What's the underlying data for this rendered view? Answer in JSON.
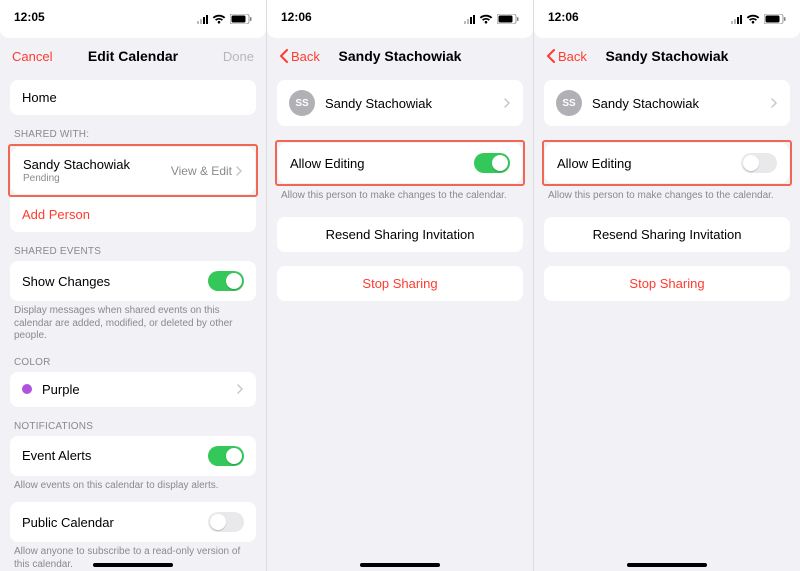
{
  "status": {
    "signal_label": "signal",
    "wifi_label": "wifi",
    "battery_label": "battery"
  },
  "screens": [
    {
      "time": "12:05",
      "nav": {
        "left": "Cancel",
        "title": "Edit Calendar",
        "right": "Done",
        "back_arrow": false
      },
      "cal_name": "Home",
      "headers": {
        "shared_with": "SHARED WITH:",
        "shared_events": "SHARED EVENTS",
        "color": "COLOR",
        "notifications": "NOTIFICATIONS"
      },
      "shared_person": {
        "name": "Sandy Stachowiak",
        "status": "Pending",
        "perm": "View & Edit"
      },
      "add_person": "Add Person",
      "show_changes": {
        "label": "Show Changes",
        "on": true
      },
      "show_changes_footer": "Display messages when shared events on this calendar are added, modified, or deleted by other people.",
      "color_row": "Purple",
      "event_alerts": {
        "label": "Event Alerts",
        "on": true
      },
      "event_alerts_footer": "Allow events on this calendar to display alerts.",
      "public_cal": {
        "label": "Public Calendar",
        "on": false
      },
      "public_cal_footer": "Allow anyone to subscribe to a read-only version of this calendar."
    },
    {
      "time": "12:06",
      "nav": {
        "left": "Back",
        "title": "Sandy Stachowiak",
        "right": "",
        "back_arrow": true
      },
      "person": {
        "initials": "SS",
        "name": "Sandy Stachowiak"
      },
      "allow_editing": {
        "label": "Allow Editing",
        "on": true
      },
      "allow_editing_footer": "Allow this person to make changes to the calendar.",
      "resend": "Resend Sharing Invitation",
      "stop": "Stop Sharing"
    },
    {
      "time": "12:06",
      "nav": {
        "left": "Back",
        "title": "Sandy Stachowiak",
        "right": "",
        "back_arrow": true
      },
      "person": {
        "initials": "SS",
        "name": "Sandy Stachowiak"
      },
      "allow_editing": {
        "label": "Allow Editing",
        "on": false
      },
      "allow_editing_footer": "Allow this person to make changes to the calendar.",
      "resend": "Resend Sharing Invitation",
      "stop": "Stop Sharing"
    }
  ]
}
